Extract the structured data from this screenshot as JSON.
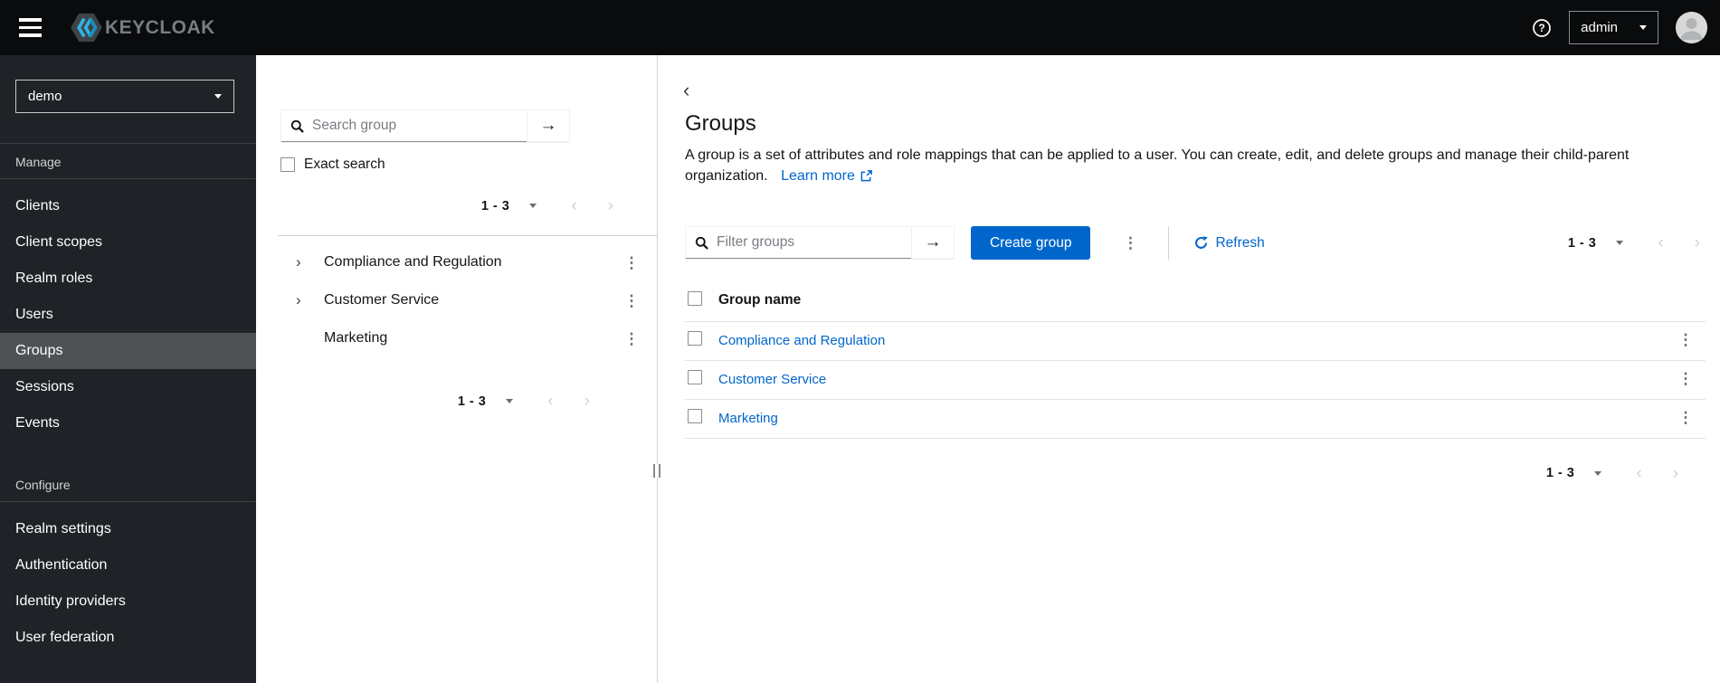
{
  "colors": {
    "accent": "#0066cc",
    "link": "#0066cc",
    "brand_cyan": "#2db3e2",
    "masthead_bg": "#0a0b0c",
    "sidebar_bg": "#1f2226",
    "sidebar_selected_bg": "#4f5255"
  },
  "icons": {
    "help": "?",
    "arrow_right": "→",
    "kebab": "⋮",
    "chevron_left": "‹",
    "chevron_right": "›",
    "chevron_expand": "›"
  },
  "masthead": {
    "brand": "KEYCLOAK",
    "username": "admin"
  },
  "sidebar": {
    "realm": "demo",
    "sections": [
      {
        "label": "Manage",
        "items": [
          "Clients",
          "Client scopes",
          "Realm roles",
          "Users",
          "Groups",
          "Sessions",
          "Events"
        ],
        "selected": "Groups"
      },
      {
        "label": "Configure",
        "items": [
          "Realm settings",
          "Authentication",
          "Identity providers",
          "User federation"
        ]
      }
    ]
  },
  "tree_panel": {
    "search_placeholder": "Search group",
    "exact_search_label": "Exact search",
    "pagination_top": "1 - 3",
    "pagination_bottom": "1 - 3",
    "groups": [
      {
        "name": "Compliance and Regulation",
        "expandable": true
      },
      {
        "name": "Customer Service",
        "expandable": true
      },
      {
        "name": "Marketing",
        "expandable": false
      }
    ]
  },
  "main": {
    "title": "Groups",
    "description": "A group is a set of attributes and role mappings that can be applied to a user. You can create, edit, and delete groups and manage their child-parent organization.",
    "learn_more_label": "Learn more",
    "toolbar": {
      "filter_placeholder": "Filter groups",
      "create_label": "Create group",
      "refresh_label": "Refresh",
      "pagination": "1 - 3"
    },
    "table": {
      "header": "Group name",
      "rows": [
        "Compliance and Regulation",
        "Customer Service",
        "Marketing"
      ]
    },
    "pagination_bottom": "1 - 3"
  }
}
